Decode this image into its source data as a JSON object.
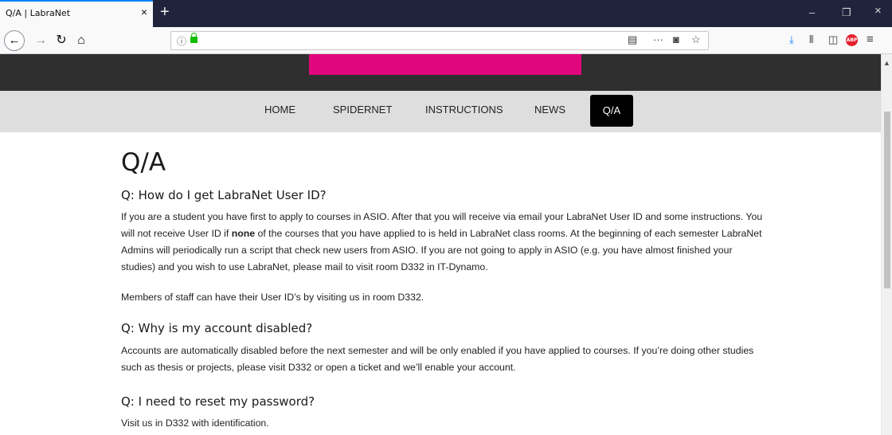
{
  "browser": {
    "tab_title": "Q/A | LabraNet",
    "tab_close": "×",
    "new_tab": "+",
    "url_info_icon": "ⓘ",
    "window_controls": {
      "minimize": "–",
      "restore": "❐",
      "close": "×"
    },
    "toolbar_icons": [
      "reader-view-icon",
      "page-actions-icon",
      "pocket-icon",
      "bookmark-star-icon",
      "download-icon",
      "library-icon",
      "sidebar-icon",
      "adblock-icon",
      "menu-icon"
    ],
    "abp_label": "ABP"
  },
  "site": {
    "brand_color": "#e0077d",
    "nav": [
      {
        "label": "HOME"
      },
      {
        "label": "SPIDERNET"
      },
      {
        "label": "INSTRUCTIONS"
      },
      {
        "label": "NEWS"
      },
      {
        "label": "Q/A",
        "active": true
      }
    ]
  },
  "page": {
    "title": "Q/A",
    "q1": {
      "question": "Q: How do I get LabraNet User ID?",
      "p1_before": "If you are a student you have first to apply to courses in ASIO. After that you will receive via email your LabraNet User ID and some instructions. You will not receive User ID if ",
      "p1_bold": "none",
      "p1_after": " of the courses that you have applied to is held in LabraNet class rooms. At the beginning of each semester LabraNet Admins will periodically run a script that check new users from ASIO. If you are not going to apply in ASIO (e.g. you have almost finished your studies) and you wish to use LabraNet, please mail to visit room D332 in IT-Dynamo.",
      "p2": "Members of staff can have their User ID’s by visiting us in room D332."
    },
    "q2": {
      "question": "Q: Why is my account disabled?",
      "p1": "Accounts are automatically disabled before the next semester and will be only enabled if you have applied to courses. If you’re doing other studies such as thesis or projects, please visit D332 or open a ticket and we’ll enable your account."
    },
    "q3": {
      "question": "Q: I need to reset my password?",
      "p1": "Visit us in D332 with identification."
    }
  }
}
